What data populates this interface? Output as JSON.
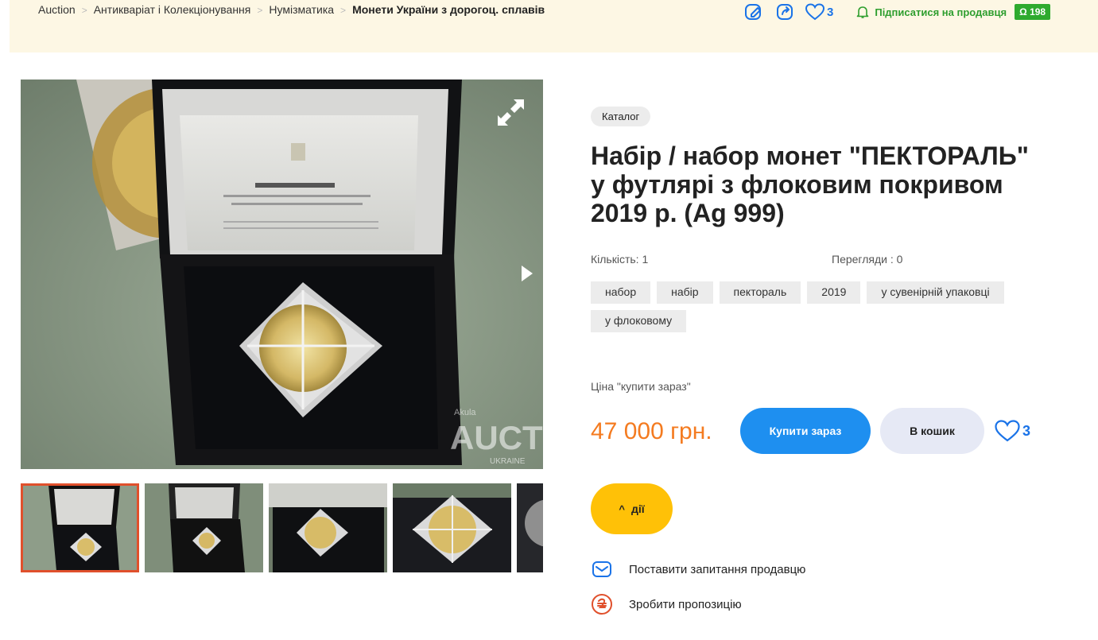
{
  "breadcrumbs": {
    "items": [
      "Auction",
      "Антикваріат і Колекціонування",
      "Нумізматика"
    ],
    "current": "Монети України з дорогоц. сплавів",
    "separator": ">"
  },
  "top_actions": {
    "likes_count": "3",
    "subscribe_label": "Підписатися на продавця",
    "seller_rating": "198"
  },
  "gallery": {
    "watermark_main": "AUCTION",
    "watermark_sub": "UKRAINE",
    "watermark_user": "Akula",
    "thumbnails_count": 5,
    "active_thumbnail": 1
  },
  "lot": {
    "category_badge": "Каталог",
    "title": "Набір / набор монет \"ПЕКТОРАЛЬ\" у футлярі з флоковим покривом 2019 р. (Ag 999)",
    "quantity": "Кількість: 1",
    "views": "Перегляди : 0",
    "tags": [
      "набор",
      "набір",
      "пектораль",
      "2019",
      "у сувенірній упаковці",
      "у флоковому"
    ],
    "price_label": "Ціна \"купити зараз\"",
    "price": "47 000 грн.",
    "buy_now_label": "Купити зараз",
    "add_to_cart_label": "В кошик",
    "likes_count": "3",
    "actions_label": "дії",
    "ask_seller_label": "Поставити запитання продавцю",
    "make_offer_label": "Зробити пропозицію"
  },
  "colors": {
    "accent_blue": "#1e8ff0",
    "price_orange": "#f47b20",
    "actions_yellow": "#ffc107",
    "topbar_bg": "#fdf7e4",
    "success_green": "#2eaa2e"
  }
}
